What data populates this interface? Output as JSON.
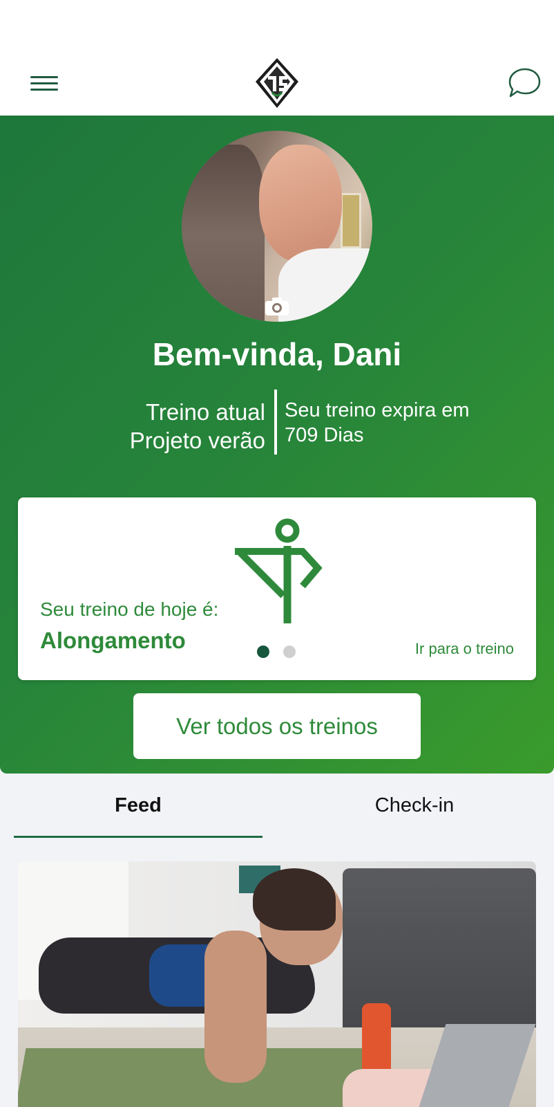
{
  "header": {
    "menu_icon": "hamburger-menu-icon",
    "logo_icon": "brand-logo-icon",
    "chat_icon": "chat-bubble-icon"
  },
  "profile": {
    "welcome": "Bem-vinda, Dani",
    "current_training_label": "Treino atual",
    "current_training_name": "Projeto verão",
    "expires_label": "Seu treino expira em",
    "expires_value": "709 Dias"
  },
  "today_card": {
    "label": "Seu treino de hoje é:",
    "workout_name": "Alongamento",
    "go_link": "Ir para o treino",
    "pager": {
      "total": 2,
      "active": 1
    }
  },
  "view_all_button": "Ver todos os treinos",
  "tabs": [
    {
      "label": "Feed",
      "active": true
    },
    {
      "label": "Check-in",
      "active": false
    }
  ],
  "colors": {
    "primary_green": "#27853a",
    "dark_green": "#17573d",
    "text_green": "#2e8a3a"
  }
}
